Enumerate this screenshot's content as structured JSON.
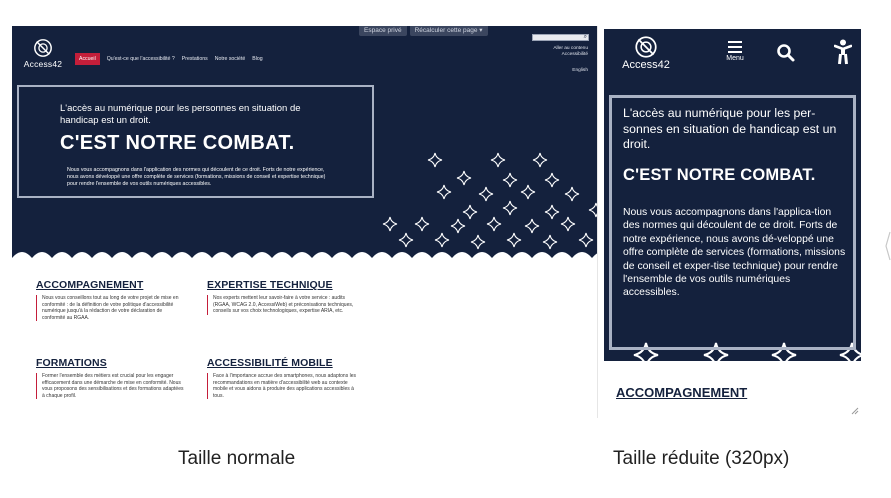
{
  "desktop": {
    "top_buttons": [
      "Espace privé",
      "Récalculer cette page ▾"
    ],
    "logo_text": "Access42",
    "nav": [
      "Accueil",
      "Qu'est-ce que l'accessibilité ?",
      "Prestations",
      "Notre société",
      "Blog"
    ],
    "skip_links": [
      "Aller au contenu",
      "Accessibilité"
    ],
    "language": "English",
    "hero": {
      "lead": "L'accès au numérique pour les personnes en situation de handicap est un droit.",
      "headline": "C'EST NOTRE COMBAT.",
      "body": "Nous vous accompagnons dans l'application des normes qui découlent de ce droit. Forts de notre expérience, nous avons développé une offre complète de services (formations, missions de conseil et expertise technique) pour rendre l'ensemble de vos outils numériques accessibles."
    },
    "cards": [
      {
        "title": "ACCOMPAGNEMENT",
        "body": "Nous vous conseillons tout au long de votre projet de mise en conformité : de la définition de votre politique d'accessibilité numérique jusqu'à la rédaction de votre déclaration de conformité au RGAA."
      },
      {
        "title": "EXPERTISE TECHNIQUE",
        "body": "Nos experts mettent leur savoir-faire à votre service : audits (RGAA, WCAG 2.0, AccessiWeb) et préconisations techniques, conseils sur vos choix technologiques, expertise ARIA, etc."
      },
      {
        "title": "FORMATIONS",
        "body": "Former l'ensemble des métiers est crucial pour les engager efficacement dans une démarche de mise en conformité. Nous vous proposons des sensibilisations et des formations adaptées à chaque profil."
      },
      {
        "title": "ACCESSIBILITÉ MOBILE",
        "body": "Face à l'importance accrue des smartphones, nous adaptons les recommandations en matière d'accessibilité web au contexte mobile et vous aidons à produire des applications accessibles à tous."
      }
    ]
  },
  "mobile": {
    "logo_text": "Access42",
    "menu_label": "Menu",
    "hero": {
      "lead": "L'accès au numérique pour les per-sonnes en situation de handicap est un droit.",
      "headline": "C'EST NOTRE COMBAT.",
      "body": "Nous vous accompagnons dans l'applica-tion des normes qui découlent de ce droit. Forts de notre expérience, nous avons dé-veloppé une offre complète de services (formations, missions de conseil et exper-tise technique) pour rendre l'ensemble de vos outils numériques accessibles."
    },
    "first_card_title": "ACCOMPAGNEMENT"
  },
  "captions": {
    "left": "Taille normale",
    "right": "Taille réduite (320px)"
  },
  "colors": {
    "navy": "#14213d",
    "accent_red": "#c41e3a",
    "frame_gray": "#a9b2c4"
  },
  "icons": [
    "access42-logo-icon",
    "search-icon",
    "hamburger-menu-icon",
    "accessibility-person-icon",
    "sparkle-star-icon",
    "resize-grip-icon"
  ]
}
